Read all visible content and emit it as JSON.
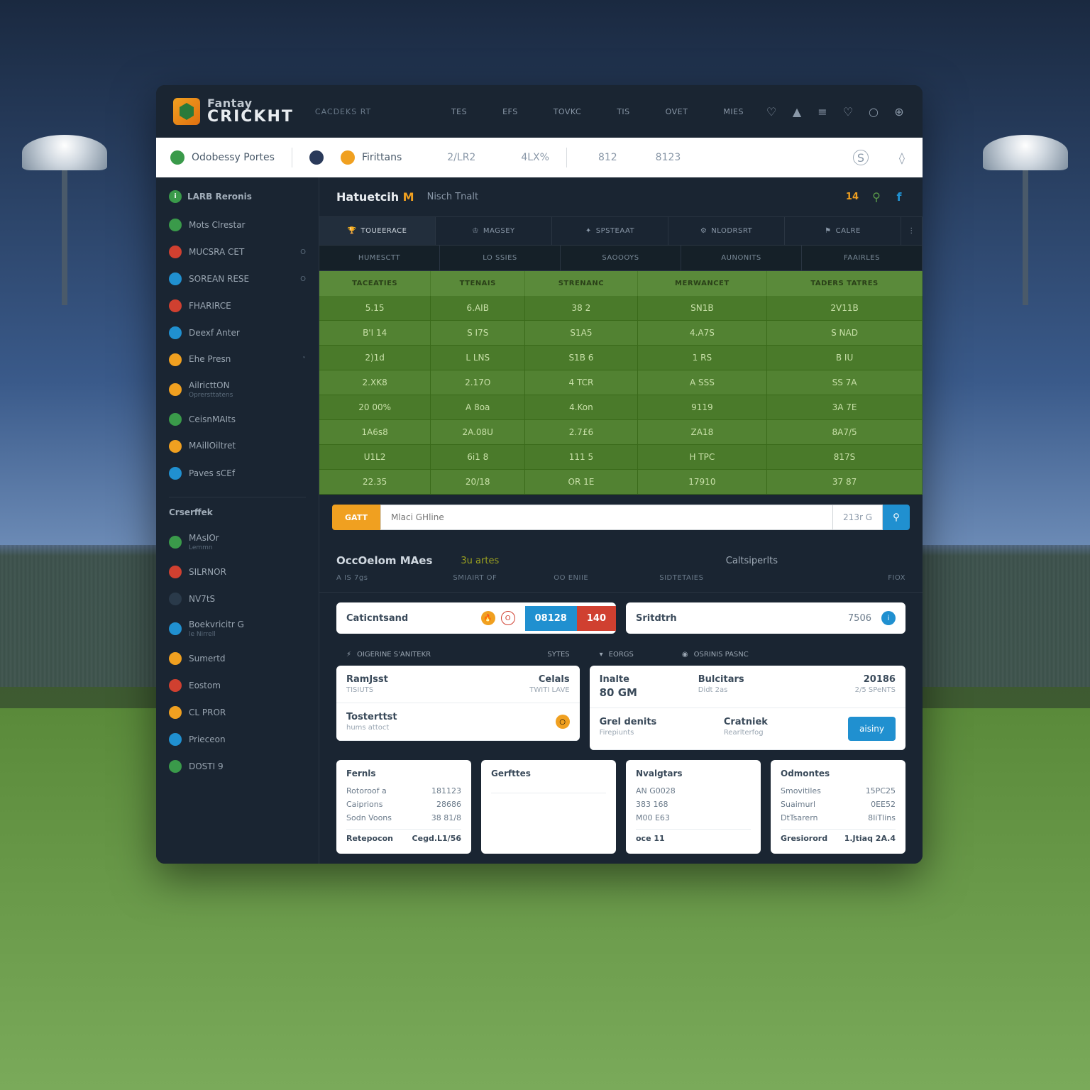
{
  "logo": {
    "top": "Fantay",
    "bottom": "CRICKHT"
  },
  "header_sub": "CACDEKS RT",
  "nav": [
    "TES",
    "EFS",
    "TOVKC",
    "TIS",
    "OVET",
    "MIES"
  ],
  "stats_bar": {
    "left_label": "Odobessy Portes",
    "mid_label": "Firittans",
    "vals": [
      "2/LR2",
      "4LX%",
      "812",
      "8123"
    ]
  },
  "sidebar": {
    "group1": "LARB Reronis",
    "group1_items": [
      {
        "label": "Mots Clrestar",
        "color": "#3a9a4a"
      },
      {
        "label": "MUCSRA CET",
        "color": "#d04030",
        "val": "O"
      },
      {
        "label": "SOREAN RESE",
        "color": "#2090d0",
        "val": "O"
      },
      {
        "label": "FHARIRCE",
        "color": "#d04030"
      },
      {
        "label": "Deexf Anter",
        "color": "#2090d0"
      },
      {
        "label": "Ehe Presn",
        "color": "#f0a020",
        "sub": "",
        "val": "˅"
      },
      {
        "label": "AilricttON",
        "color": "#f0a020",
        "sub": "Oprersttatens"
      },
      {
        "label": "CeisnMAIts",
        "color": "#3a9a4a"
      },
      {
        "label": "MAillOiltret",
        "color": "#f0a020",
        "sub": ""
      },
      {
        "label": "Paves sCEf",
        "color": "#2090d0"
      }
    ],
    "group2": "Crserffek",
    "group2_items": [
      {
        "label": "MAsIOr",
        "color": "#3a9a4a",
        "sub": "Lemmn"
      },
      {
        "label": "SILRNOR",
        "color": "#d04030"
      },
      {
        "label": "NV7tS",
        "color": "#2a3a4a"
      },
      {
        "label": "Boekvricitr G",
        "color": "#2090d0",
        "sub": "le Nirrell"
      },
      {
        "label": "Sumertd",
        "color": "#f0a020"
      },
      {
        "label": "Eostom",
        "color": "#d04030"
      },
      {
        "label": "CL PROR",
        "color": "#f0a020"
      },
      {
        "label": "Prieceon",
        "color": "#2090d0"
      },
      {
        "label": "DOSTI 9",
        "color": "#3a9a4a"
      }
    ]
  },
  "main": {
    "title_a": "Hatuetcih",
    "title_hl": "M",
    "title_b": "Nisch Tnalt",
    "badge": "14",
    "tabs": [
      "TOUEERACE",
      "MAGSEY",
      "SPSTEAAT",
      "NLODRSRT",
      "CALRE"
    ],
    "subtabs": [
      "HUMESCTT",
      "LO SSIES",
      "SAOOOYS",
      "AUNONITS",
      "FAAIRLES"
    ],
    "table": {
      "headers": [
        "TACEATIES",
        "TTENAIS",
        "STRENANC",
        "MERWANCET",
        "TADERS TATRES"
      ],
      "rows": [
        [
          "5.15",
          "6.AIB",
          "38 2",
          "SN1B",
          "2V11B"
        ],
        [
          "B'I 14",
          "S I7S",
          "S1A5",
          "4.A7S",
          "S NAD"
        ],
        [
          "2)1d",
          "L LNS",
          "S1B 6",
          "1 RS",
          "B IU"
        ],
        [
          "2.XK8",
          "2.17O",
          "4 TCR",
          "A SSS",
          "SS 7A"
        ],
        [
          "20 00%",
          "A  8oa",
          "4.Kon",
          "9119",
          "3A 7E"
        ],
        [
          "1A6s8",
          "2A.08U",
          "2.7£6",
          "ZA18",
          "8A7/5"
        ],
        [
          "U1L2",
          "6i1 8",
          "111 5",
          "H TPC",
          "817S"
        ],
        [
          "22.35",
          "20/18",
          "OR  1E",
          "17910",
          "37 87"
        ]
      ]
    },
    "input": {
      "btn": "GATT",
      "placeholder": "Mlaci GHline",
      "val": "213r G"
    }
  },
  "section": {
    "title": "OccOelom MAes",
    "sub1": "3u  artes",
    "sub2": "Caltsiperlts",
    "meta": [
      "A IS 7gs",
      "SMIAIRT OF",
      "OO  ENIIE",
      "SIDTETAIES",
      "FIOX"
    ]
  },
  "cards": {
    "left": {
      "title": "Caticntsand",
      "badge1": "O",
      "chip": "08128",
      "chip2": "140"
    },
    "right": {
      "title": "Sritdtrh",
      "val": "7506"
    }
  },
  "list_left": {
    "head": "OIGERINE S'ANITEKR",
    "head2": "SYTES",
    "rows": [
      {
        "a": "RamJsst",
        "b": "Celals",
        "sub_a": "TISIUTS",
        "sub_b": "TWITI LAVE"
      },
      {
        "a": "Tosterttst",
        "b": "",
        "sub_a": "hums attoct",
        "icon": "o"
      }
    ]
  },
  "list_right": {
    "head": "EORGS",
    "head2": "OSRINIS PASNC",
    "rows": [
      {
        "a": "Inalte",
        "b": "Bulcitars",
        "c": "20186",
        "sub_a": "80 GM",
        "sub_b": "Didt 2as",
        "sub_c": "2/5 SPeNTS"
      },
      {
        "a": "Grel denits",
        "b": "Cratniek",
        "btn": "aisiny",
        "sub_a": "Firepiunts",
        "sub_b": "Rearlterfog"
      }
    ]
  },
  "stats_cards": [
    {
      "title": "Fernls",
      "rows": [
        [
          "Rotoroof a",
          "181123"
        ],
        [
          "Caiprions",
          "28686"
        ],
        [
          "Sodn Voons",
          "38 81/8"
        ]
      ],
      "foot_a": "Retepocon",
      "foot_b": "Cegd.L1/56"
    },
    {
      "title": "Gerfttes",
      "rows": [
        [
          "",
          ""
        ]
      ],
      "foot_a": "",
      "foot_b": ""
    },
    {
      "title": "Nvalgtars",
      "rows": [
        [
          "AN G0028",
          ""
        ],
        [
          "383 168",
          ""
        ],
        [
          "M00 E63",
          ""
        ]
      ],
      "foot_a": "oce 11",
      "foot_b": ""
    },
    {
      "title": "Odmontes",
      "rows": [
        [
          "Smovitiles",
          "15PC25"
        ],
        [
          "Suaimurl",
          "0EE52"
        ],
        [
          "DtTsarern",
          "8IiTlins"
        ]
      ],
      "foot_a": "Gresiorord",
      "foot_b": "1.Jtiaq  2A.4"
    }
  ]
}
